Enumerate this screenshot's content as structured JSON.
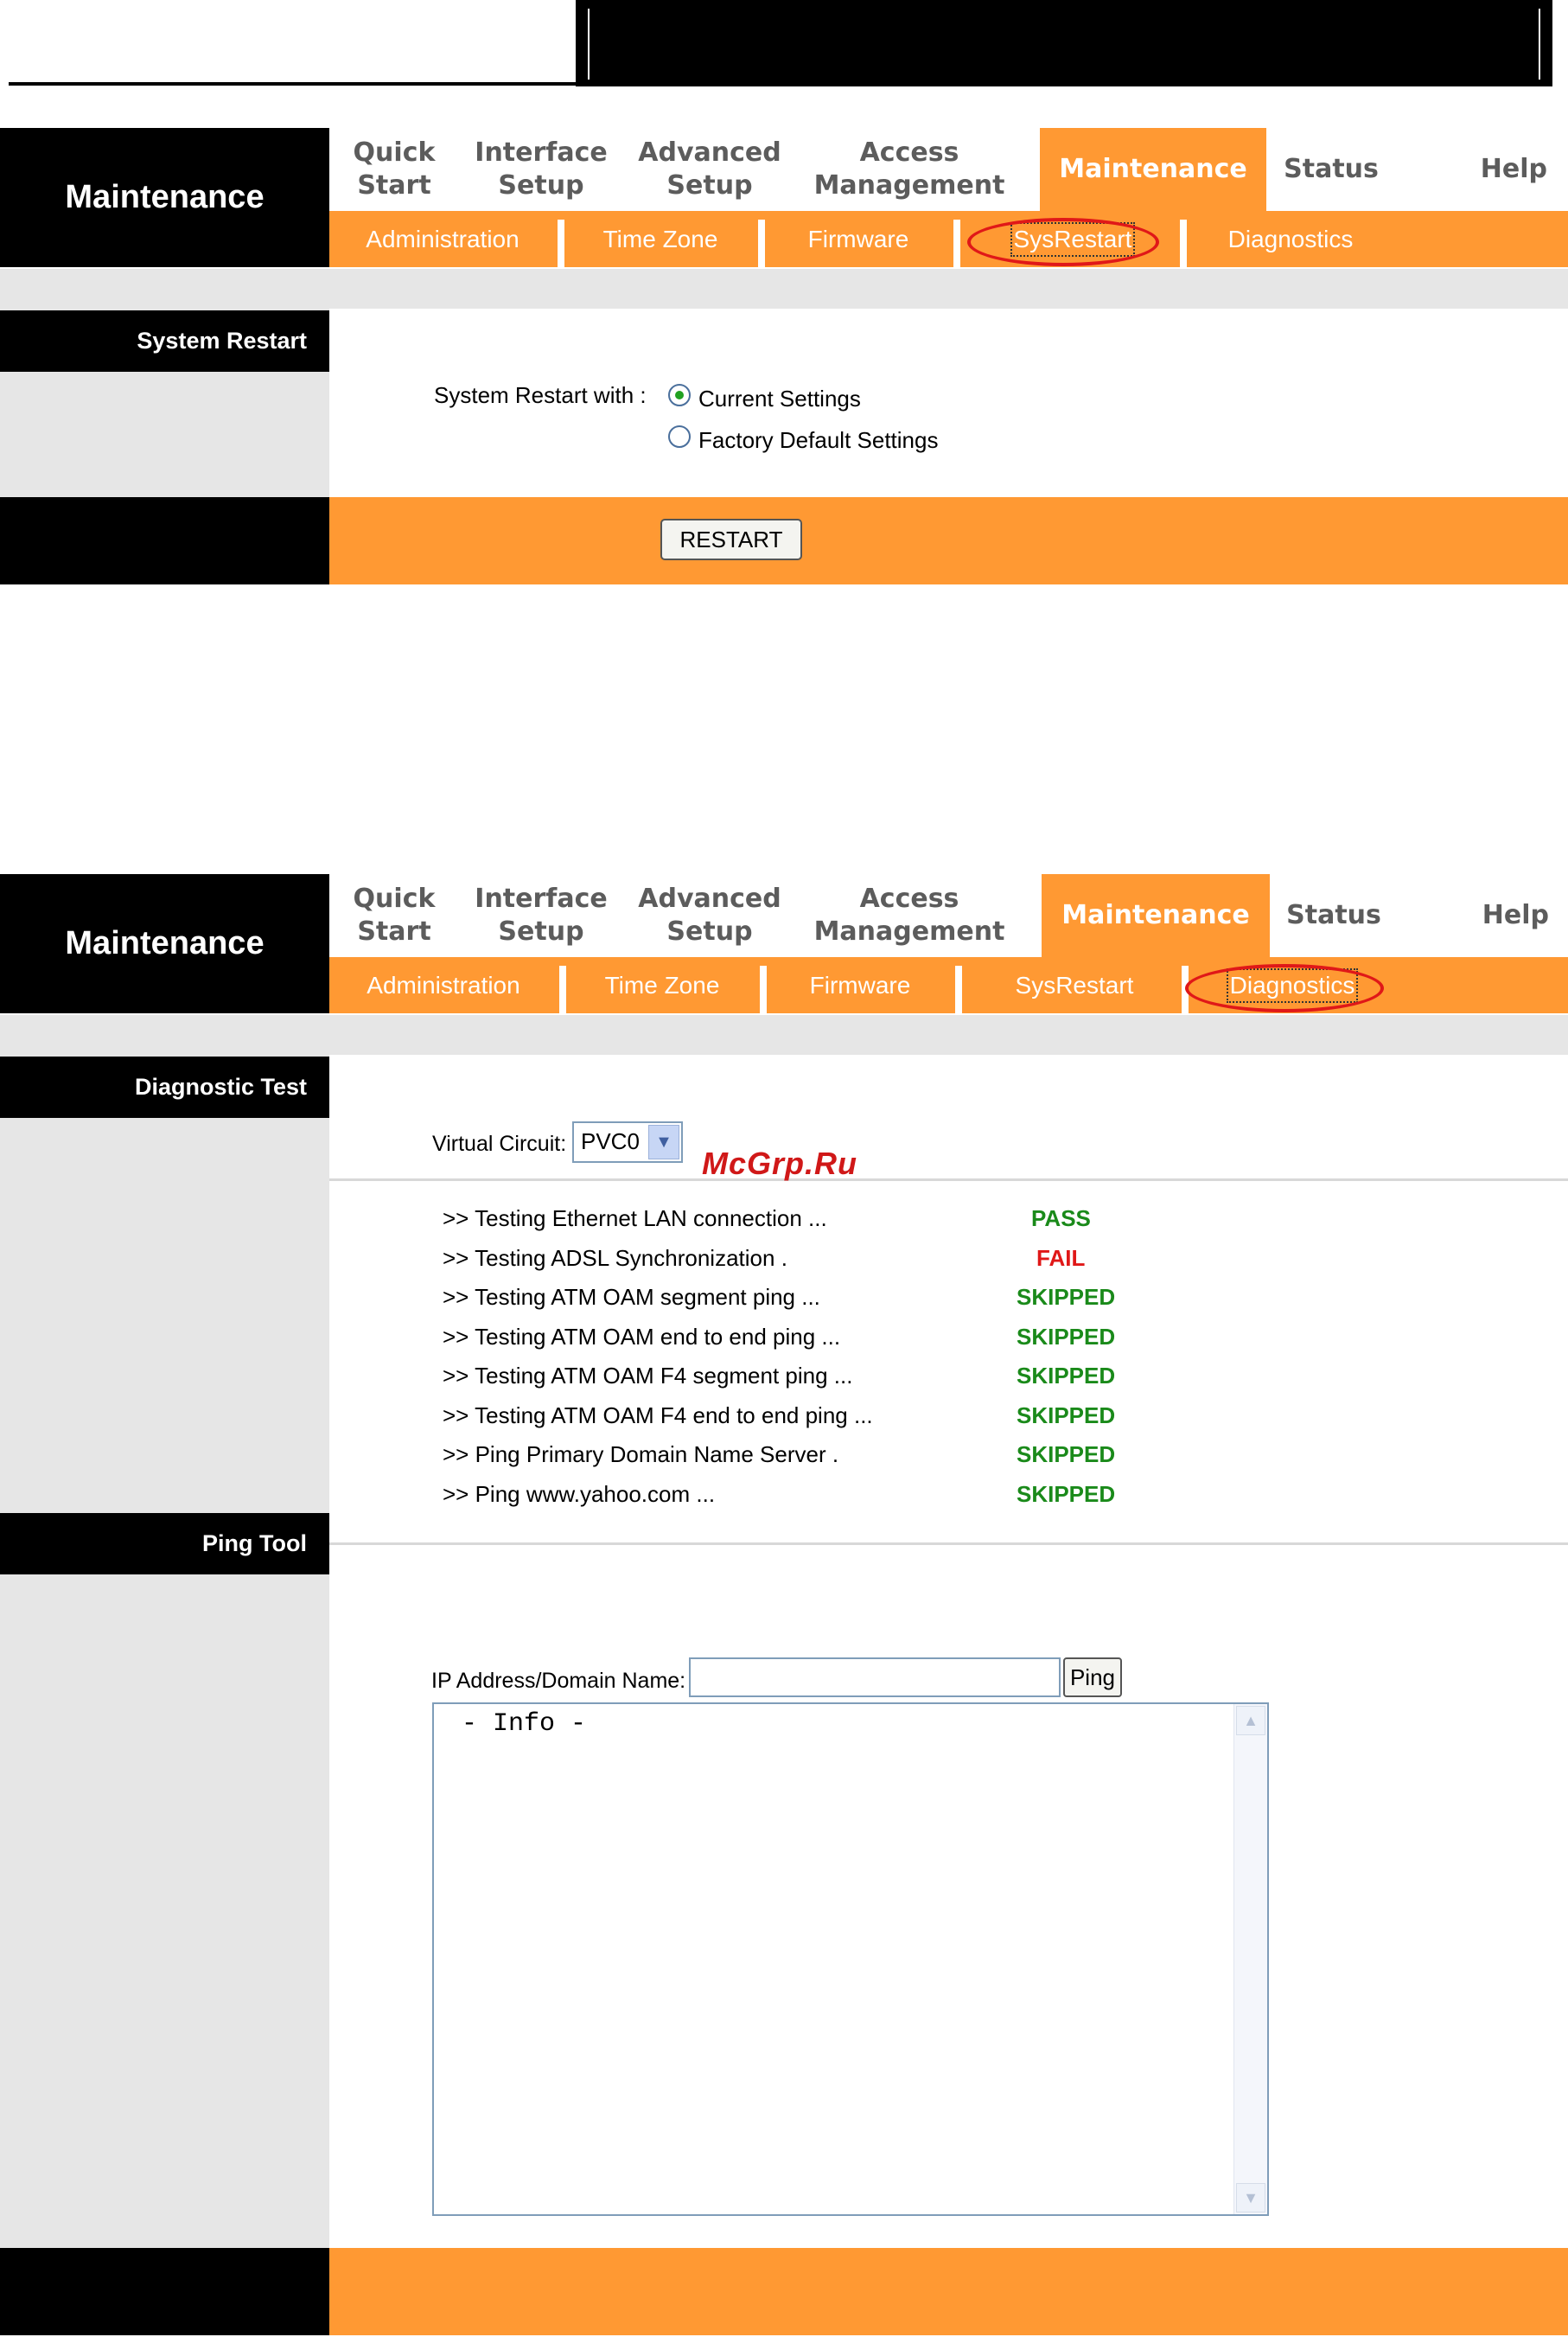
{
  "screen1": {
    "side_title": "Maintenance",
    "nav": [
      {
        "line1": "Quick",
        "line2": "Start"
      },
      {
        "line1": "Interface",
        "line2": "Setup"
      },
      {
        "line1": "Advanced",
        "line2": "Setup"
      },
      {
        "line1": "Access",
        "line2": "Management"
      },
      {
        "line1": "Maintenance",
        "line2": ""
      },
      {
        "line1": "Status",
        "line2": ""
      },
      {
        "line1": "Help",
        "line2": ""
      }
    ],
    "subnav": [
      "Administration",
      "Time Zone",
      "Firmware",
      "SysRestart",
      "Diagnostics"
    ],
    "section_label": "System Restart",
    "restart_with_label": "System Restart with :",
    "options": [
      "Current Settings",
      "Factory Default Settings"
    ],
    "selected_option": "Current Settings",
    "restart_button": "RESTART"
  },
  "screen2": {
    "side_title": "Maintenance",
    "nav": [
      {
        "line1": "Quick",
        "line2": "Start"
      },
      {
        "line1": "Interface",
        "line2": "Setup"
      },
      {
        "line1": "Advanced",
        "line2": "Setup"
      },
      {
        "line1": "Access",
        "line2": "Management"
      },
      {
        "line1": "Maintenance",
        "line2": ""
      },
      {
        "line1": "Status",
        "line2": ""
      },
      {
        "line1": "Help",
        "line2": ""
      }
    ],
    "subnav": [
      "Administration",
      "Time Zone",
      "Firmware",
      "SysRestart",
      "Diagnostics"
    ],
    "diag_label": "Diagnostic Test",
    "vc_label": "Virtual Circuit:",
    "vc_value": "PVC0",
    "tests": [
      {
        "name": ">> Testing Ethernet LAN connection ...",
        "result": "PASS"
      },
      {
        "name": ">> Testing ADSL Synchronization .",
        "result": "FAIL"
      },
      {
        "name": ">> Testing ATM OAM segment ping ...",
        "result": "SKIPPED"
      },
      {
        "name": ">> Testing ATM OAM end to end ping ...",
        "result": "SKIPPED"
      },
      {
        "name": ">> Testing ATM OAM F4 segment ping ...",
        "result": "SKIPPED"
      },
      {
        "name": ">> Testing ATM OAM F4 end to end ping ...",
        "result": "SKIPPED"
      },
      {
        "name": ">> Ping Primary Domain Name Server .",
        "result": "SKIPPED"
      },
      {
        "name": ">> Ping www.yahoo.com ...",
        "result": "SKIPPED"
      }
    ],
    "ping_label": "Ping Tool",
    "ip_label": "IP Address/Domain Name:",
    "ip_value": "",
    "ping_button": "Ping",
    "info_text": " - Info -"
  },
  "watermark": "McGrp.Ru",
  "colors": {
    "accent_orange": "#ff9933",
    "highlight_red": "#e01818",
    "pass_green": "#1a8a1a",
    "fail_red": "#e01818"
  }
}
